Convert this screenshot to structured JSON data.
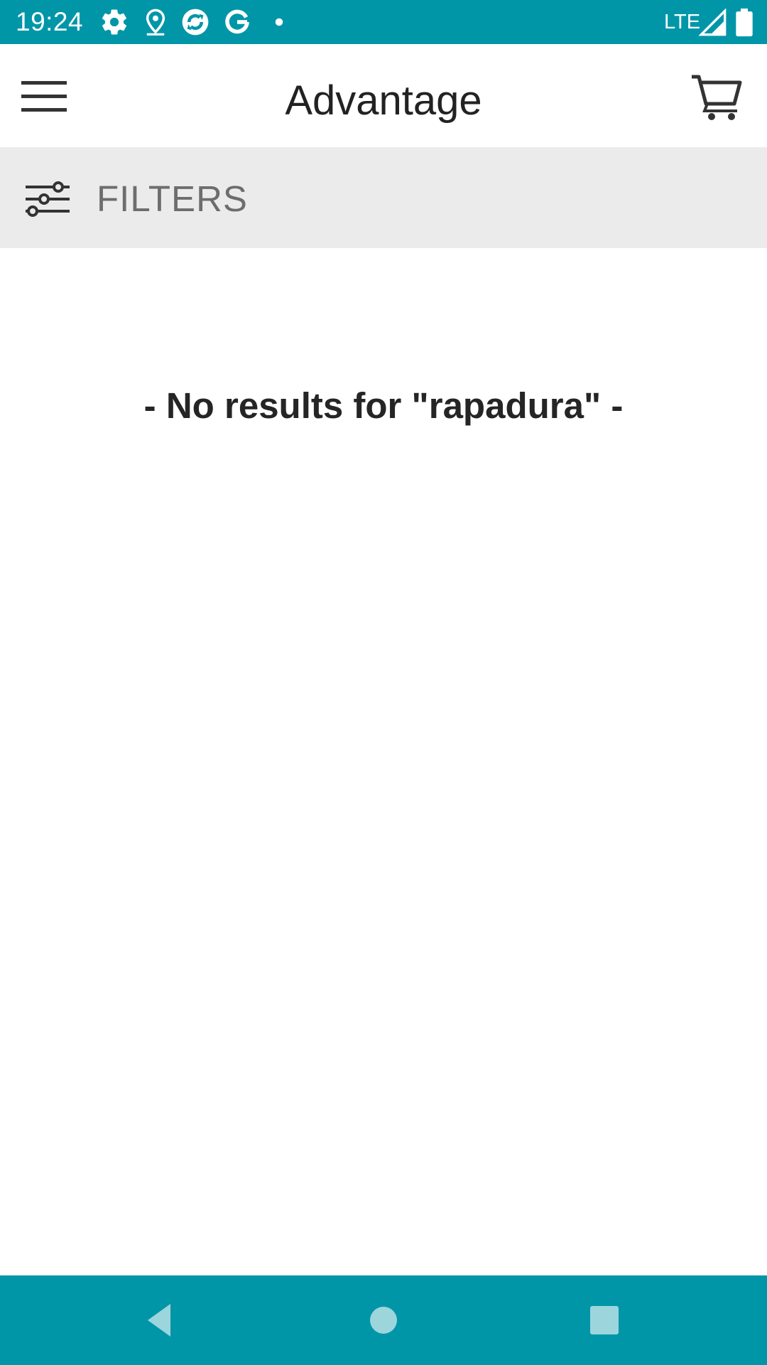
{
  "status_bar": {
    "time": "19:24",
    "network": "LTE",
    "icons": [
      "settings-icon",
      "location-icon",
      "sync-app-icon",
      "google-icon",
      "notification-dot-icon",
      "signal-icon",
      "battery-icon"
    ],
    "background_color": "#0096a8"
  },
  "app_bar": {
    "title": "Advantage",
    "menu_icon": "hamburger-menu-icon",
    "cart_icon": "shopping-cart-icon"
  },
  "filters": {
    "label": "FILTERS",
    "icon": "sliders-icon"
  },
  "content": {
    "message": "- No results for \"rapadura\" -"
  },
  "nav_bar": {
    "buttons": [
      "back-icon",
      "home-icon",
      "recents-icon"
    ],
    "background_color": "#0096a8"
  }
}
